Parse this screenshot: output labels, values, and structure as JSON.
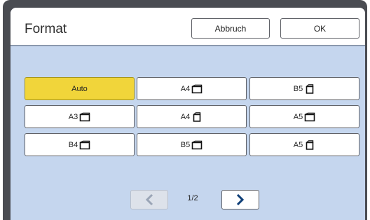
{
  "header": {
    "title": "Format",
    "cancel_label": "Abbruch",
    "ok_label": "OK"
  },
  "formats": [
    {
      "label": "Auto",
      "selected": true,
      "icon": ""
    },
    {
      "label": "A4",
      "icon": "landscape-paper-icon"
    },
    {
      "label": "B5",
      "icon": "portrait-paper-icon"
    },
    {
      "label": "A3",
      "icon": "landscape-paper-icon"
    },
    {
      "label": "A4",
      "icon": "portrait-paper-icon"
    },
    {
      "label": "A5",
      "icon": "landscape-paper-icon"
    },
    {
      "label": "B4",
      "icon": "landscape-paper-icon"
    },
    {
      "label": "B5",
      "icon": "landscape-paper-icon"
    },
    {
      "label": "A5",
      "icon": "portrait-paper-icon"
    }
  ],
  "pagination": {
    "page_text": "1/2",
    "prev_enabled": false,
    "next_enabled": true
  },
  "colors": {
    "selected_fill": "#f1d53a",
    "panel_bg": "#c5d6ee",
    "frame": "#4a4c52"
  }
}
